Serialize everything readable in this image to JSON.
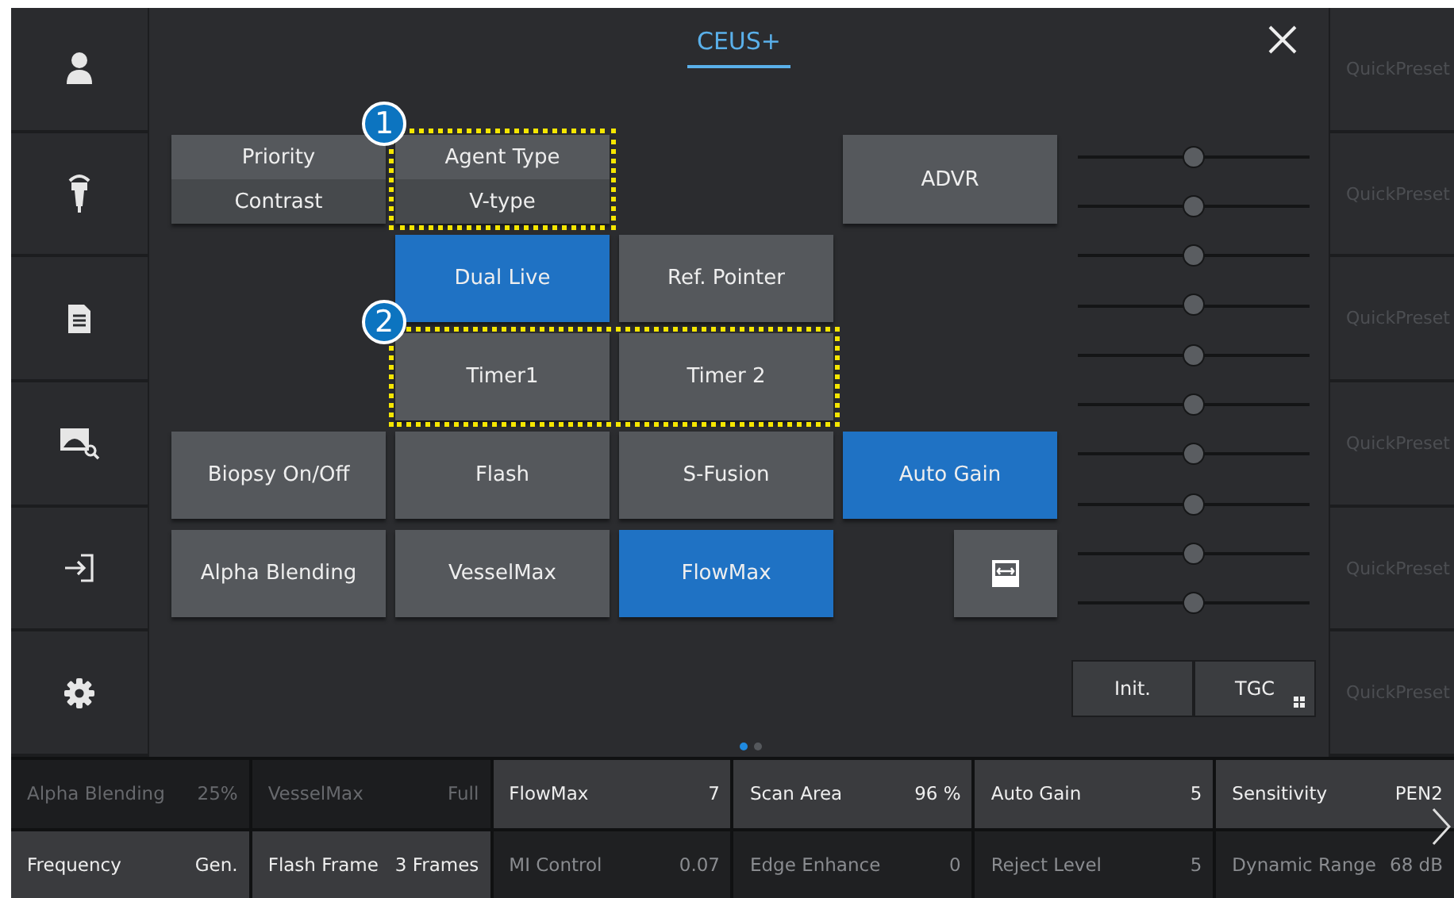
{
  "title": {
    "label": "CEUS+",
    "selected": true
  },
  "buttons": [
    {
      "kind": "split",
      "label": "Priority",
      "value": "Contrast"
    },
    {
      "kind": "split",
      "label": "Agent Type",
      "value": "V-type"
    },
    {
      "kind": "text",
      "label": "ADVR",
      "on": false
    },
    {
      "kind": "text",
      "label": "Dual Live",
      "on": true
    },
    {
      "kind": "text",
      "label": "Ref. Pointer",
      "on": false
    },
    {
      "kind": "text",
      "label": "Timer1",
      "on": false
    },
    {
      "kind": "text",
      "label": "Timer 2",
      "on": false
    },
    {
      "kind": "text",
      "label": "Biopsy On/Off",
      "on": false
    },
    {
      "kind": "text",
      "label": "Flash",
      "on": false
    },
    {
      "kind": "text",
      "label": "S-Fusion",
      "on": false
    },
    {
      "kind": "text",
      "label": "Auto Gain",
      "on": true
    },
    {
      "kind": "text",
      "label": "Alpha Blending",
      "on": false
    },
    {
      "kind": "text",
      "label": "VesselMax",
      "on": false
    },
    {
      "kind": "text",
      "label": "FlowMax",
      "on": true
    },
    {
      "kind": "icon",
      "on": false
    }
  ],
  "callouts": [
    {
      "number": "1"
    },
    {
      "number": "2"
    }
  ],
  "tgc_sliders": [
    {
      "level": 0.5
    },
    {
      "level": 0.5
    },
    {
      "level": 0.5
    },
    {
      "level": 0.5
    },
    {
      "level": 0.5
    },
    {
      "level": 0.5
    },
    {
      "level": 0.5
    },
    {
      "level": 0.5
    },
    {
      "level": 0.5
    },
    {
      "level": 0.5
    }
  ],
  "tgc_buttons": [
    {
      "label": "Init.",
      "grid": false
    },
    {
      "label": "TGC",
      "grid": true
    }
  ],
  "pages": [
    {
      "selected": true
    },
    {
      "selected": false
    }
  ],
  "quick_presets": [
    "QuickPreset",
    "QuickPreset",
    "QuickPreset",
    "QuickPreset",
    "QuickPreset",
    "QuickPreset"
  ],
  "parameters": [
    {
      "name": "Alpha Blending",
      "value": "25%",
      "highlighted": false,
      "disabled": true
    },
    {
      "name": "VesselMax",
      "value": "Full",
      "highlighted": false,
      "disabled": true
    },
    {
      "name": "FlowMax",
      "value": "7",
      "highlighted": true,
      "disabled": false
    },
    {
      "name": "Scan Area",
      "value": "96 %",
      "highlighted": true,
      "disabled": false
    },
    {
      "name": "Auto Gain",
      "value": "5",
      "highlighted": true,
      "disabled": false
    },
    {
      "name": "Sensitivity",
      "value": "PEN2",
      "highlighted": true,
      "disabled": false
    },
    {
      "name": "Frequency",
      "value": "Gen.",
      "highlighted": true,
      "disabled": false
    },
    {
      "name": "Flash Frame",
      "value": "3 Frames",
      "highlighted": true,
      "disabled": false
    },
    {
      "name": "MI Control",
      "value": "0.07",
      "highlighted": false,
      "disabled": false
    },
    {
      "name": "Edge Enhance",
      "value": "0",
      "highlighted": false,
      "disabled": false
    },
    {
      "name": "Reject Level",
      "value": "5",
      "highlighted": false,
      "disabled": false
    },
    {
      "name": "Dynamic Range",
      "value": "68 dB",
      "highlighted": false,
      "disabled": false
    }
  ]
}
